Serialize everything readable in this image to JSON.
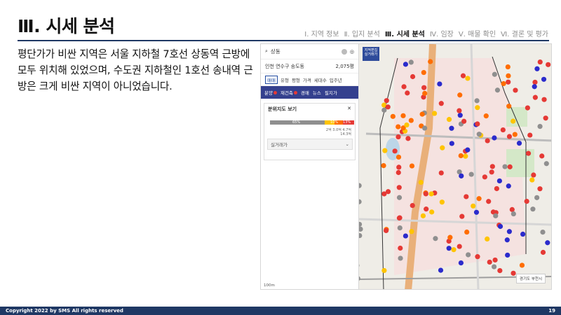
{
  "slide": {
    "title": "Ⅲ. 시세 분석",
    "nav": [
      "Ⅰ. 지역 정보",
      "Ⅱ. 입지 분석",
      "Ⅲ. 시세 분석",
      "Ⅳ. 임장",
      "Ⅴ. 매물 확인",
      "Ⅵ. 결론 및 평가"
    ],
    "active_nav": 2,
    "body": "평단가가 비싼 지역은 서울 지하철 7호선 상동역 근방에 모두 위치해 있었으며, 수도권 지하철인 1호선 송내역 근방은 크게 비싼 지역이 아니었습니다."
  },
  "map": {
    "search_query": "상동",
    "location": "인천 연수구 송도동",
    "unit_price": "2,075평",
    "tabs": [
      "매매",
      "유형",
      "평형",
      "가격",
      "세대수",
      "입주년"
    ],
    "nav_items": [
      "분양",
      "재건축",
      "경매",
      "뉴스",
      "필지가"
    ],
    "panel_title": "분위지도 보기",
    "bar_labels": [
      "65%",
      "10%",
      "13%"
    ],
    "bar_sub": [
      "2억 3.0억 4.7억",
      "14.3억"
    ],
    "dropdown_label": "실거래가",
    "overlay_button": "지적편집 실거래가",
    "district_tag": "경기도 부천시",
    "scale": "100m",
    "colors": {
      "expensive": "#e53935",
      "orange": "#ff6d00",
      "yellow": "#ffc400",
      "blue": "#2b2bcc",
      "gray": "#8f8f8f"
    }
  },
  "footer": {
    "copyright": "Copyright 2022 by SMS All rights reserved",
    "page": "19"
  }
}
